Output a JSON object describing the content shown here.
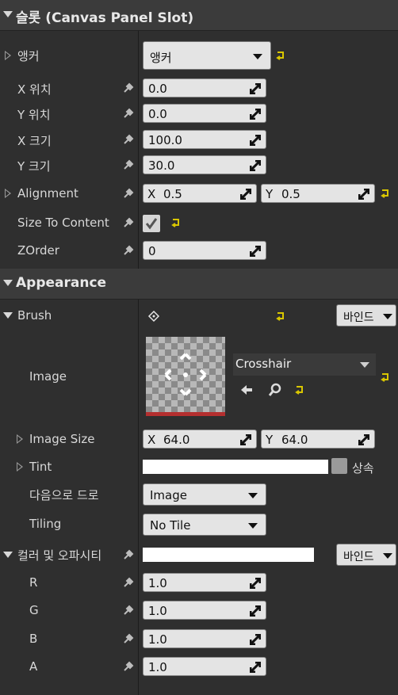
{
  "sections": {
    "slot_title": "슬롯 (Canvas Panel Slot)",
    "appearance_title": "Appearance"
  },
  "slot": {
    "anchor": {
      "label": "앵커",
      "value": "앵커"
    },
    "x_pos": {
      "label": "X 위치",
      "value": "0.0"
    },
    "y_pos": {
      "label": "Y 위치",
      "value": "0.0"
    },
    "x_size": {
      "label": "X 크기",
      "value": "100.0"
    },
    "y_size": {
      "label": "Y 크기",
      "value": "30.0"
    },
    "alignment": {
      "label": "Alignment",
      "x_axis": "X",
      "x": "0.5",
      "y_axis": "Y",
      "y": "0.5"
    },
    "size_to_content": {
      "label": "Size To Content",
      "checked": true
    },
    "zorder": {
      "label": "ZOrder",
      "value": "0"
    }
  },
  "appearance": {
    "brush": {
      "label": "Brush",
      "bind_label": "바인드"
    },
    "image": {
      "label": "Image",
      "asset": "Crosshair"
    },
    "image_size": {
      "label": "Image Size",
      "x_axis": "X",
      "x": "64.0",
      "y_axis": "Y",
      "y": "64.0"
    },
    "tint": {
      "label": "Tint",
      "inherit_label": "상속"
    },
    "draw_as": {
      "label": "다음으로 드로",
      "value": "Image"
    },
    "tiling": {
      "label": "Tiling",
      "value": "No Tile"
    },
    "color_opacity": {
      "label": "컬러 및 오파시티",
      "bind_label": "바인드"
    },
    "r": {
      "label": "R",
      "value": "1.0"
    },
    "g": {
      "label": "G",
      "value": "1.0"
    },
    "b": {
      "label": "B",
      "value": "1.0"
    },
    "a": {
      "label": "A",
      "value": "1.0"
    }
  },
  "colors": {
    "reset_arrow": "#d9c600",
    "thumbnail_border": "#b42f2f",
    "field_bg": "#e4e4e4",
    "panel_bg": "#2f2f2f"
  }
}
